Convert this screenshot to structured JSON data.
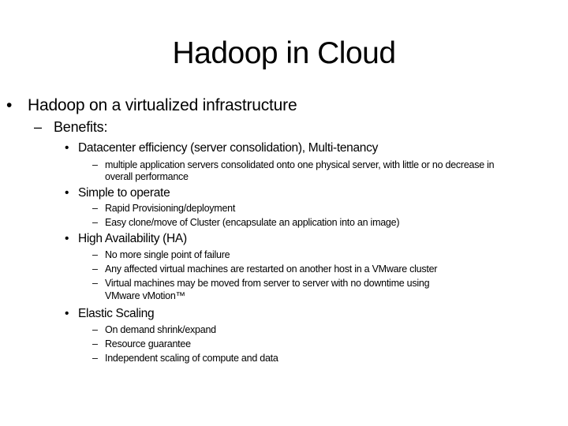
{
  "slide": {
    "title": "Hadoop in Cloud",
    "bullet_glyph": "•",
    "dash_glyph": "–",
    "level1": {
      "text": "Hadoop on a virtualized infrastructure"
    },
    "level2": {
      "text": "Benefits:"
    },
    "sections": [
      {
        "heading": "Datacenter efficiency (server consolidation), Multi-tenancy",
        "items": [
          {
            "line1": "multiple application servers consolidated onto one physical server, with little or no decrease in",
            "line2": "overall performance"
          }
        ]
      },
      {
        "heading": "Simple to operate",
        "items": [
          {
            "line1": "Rapid Provisioning/deployment"
          },
          {
            "line1": "Easy clone/move of Cluster (encapsulate an application into an image)"
          }
        ]
      },
      {
        "heading": "High Availability (HA)",
        "items": [
          {
            "line1": "No more single point of failure"
          },
          {
            "line1": "Any affected virtual machines are restarted on another host in a VMware cluster"
          },
          {
            "line1": "Virtual machines may be moved from server to server with no downtime using",
            "line2": "VMware vMotion™"
          }
        ]
      },
      {
        "heading": "Elastic Scaling",
        "items": [
          {
            "line1": "On demand shrink/expand"
          },
          {
            "line1": "Resource guarantee"
          },
          {
            "line1": "Independent scaling of compute and data"
          }
        ]
      }
    ]
  }
}
